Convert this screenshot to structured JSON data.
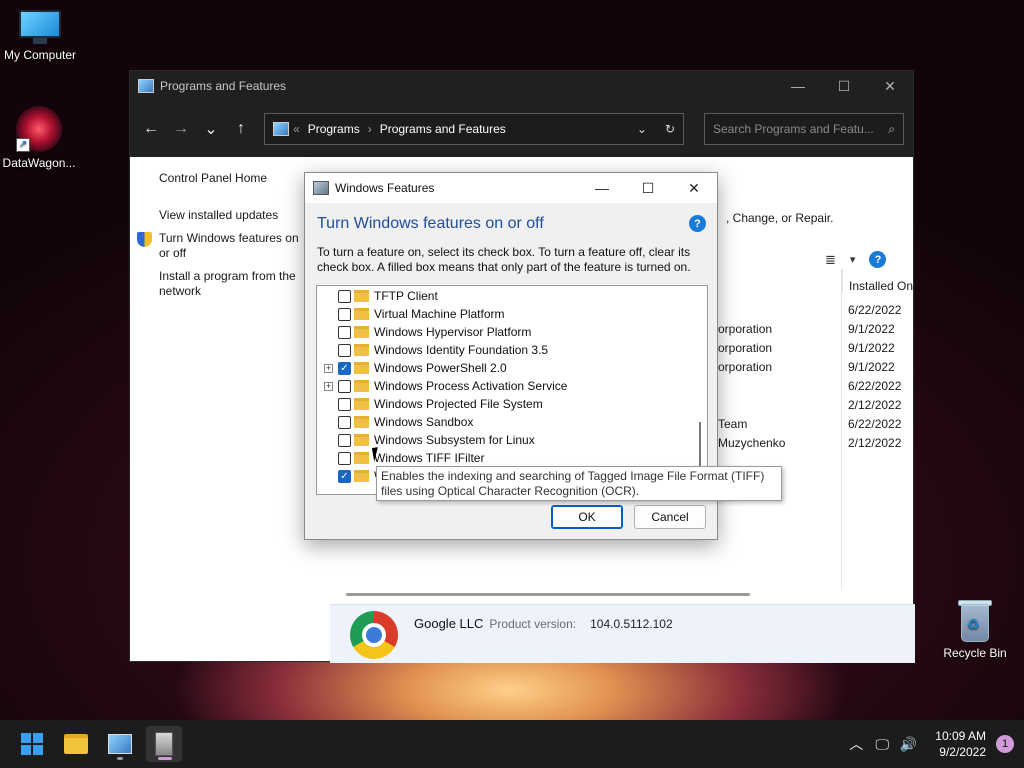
{
  "desktop": {
    "icons": [
      {
        "label": "My Computer"
      },
      {
        "label": "DataWagon..."
      },
      {
        "label": "Recycle Bin"
      }
    ]
  },
  "main_window": {
    "title": "Programs and Features",
    "controls": {
      "minimize": "—",
      "maximize": "☐",
      "close": "✕"
    },
    "nav": {
      "back": "←",
      "forward": "→",
      "recent": "⌄",
      "up": "↑"
    },
    "address": {
      "overflow": "«",
      "crumb1": "Programs",
      "separator": "›",
      "crumb2": "Programs and Features",
      "dropdown": "⌄",
      "refresh": "↻"
    },
    "search_placeholder": "Search Programs and Featu...",
    "search_icon": "⌕",
    "sidebar": {
      "home": "Control Panel Home",
      "updates": "View installed updates",
      "features": "Turn Windows features on or off",
      "install": "Install a program from the network"
    },
    "body_text": ", Change, or Repair.",
    "view_icon": "≣",
    "view_dropdown": "▾",
    "help": "?",
    "column_installed_on": "Installed On",
    "publisher_fragments": [
      "orporation",
      "orporation",
      "orporation",
      "",
      "",
      " Team",
      "Muzychenko"
    ],
    "installed_dates": [
      "6/22/2022",
      "9/1/2022",
      "9/1/2022",
      "9/1/2022",
      "6/22/2022",
      "2/12/2022",
      "6/22/2022",
      "2/12/2022"
    ],
    "details": {
      "publisher": "Google LLC",
      "product_version_label": "Product version:",
      "product_version": "104.0.5112.102"
    }
  },
  "dialog": {
    "title": "Windows Features",
    "controls": {
      "minimize": "—",
      "maximize": "☐",
      "close": "✕"
    },
    "heading": "Turn Windows features on or off",
    "help": "?",
    "description": "To turn a feature on, select its check box. To turn a feature off, clear its check box. A filled box means that only part of the feature is turned on.",
    "features": [
      {
        "label": "TFTP Client",
        "checked": false,
        "expandable": false
      },
      {
        "label": "Virtual Machine Platform",
        "checked": false,
        "expandable": false
      },
      {
        "label": "Windows Hypervisor Platform",
        "checked": false,
        "expandable": false
      },
      {
        "label": "Windows Identity Foundation 3.5",
        "checked": false,
        "expandable": false
      },
      {
        "label": "Windows PowerShell 2.0",
        "checked": true,
        "expandable": true
      },
      {
        "label": "Windows Process Activation Service",
        "checked": false,
        "expandable": true
      },
      {
        "label": "Windows Projected File System",
        "checked": false,
        "expandable": false
      },
      {
        "label": "Windows Sandbox",
        "checked": false,
        "expandable": false
      },
      {
        "label": "Windows Subsystem for Linux",
        "checked": false,
        "expandable": false
      },
      {
        "label": "Windows TIFF IFilter",
        "checked": false,
        "expandable": false
      },
      {
        "label": "W",
        "checked": true,
        "expandable": false
      }
    ],
    "tooltip": "Enables the indexing and searching of Tagged Image File Format (TIFF) files using Optical Character Recognition (OCR).",
    "ok_label": "OK",
    "cancel_label": "Cancel"
  },
  "taskbar": {
    "clock_time": "10:09 AM",
    "clock_date": "9/2/2022",
    "notification_count": "1",
    "tray_chevron": "︿",
    "tray_network": "🖵",
    "tray_volume": "🔊"
  }
}
